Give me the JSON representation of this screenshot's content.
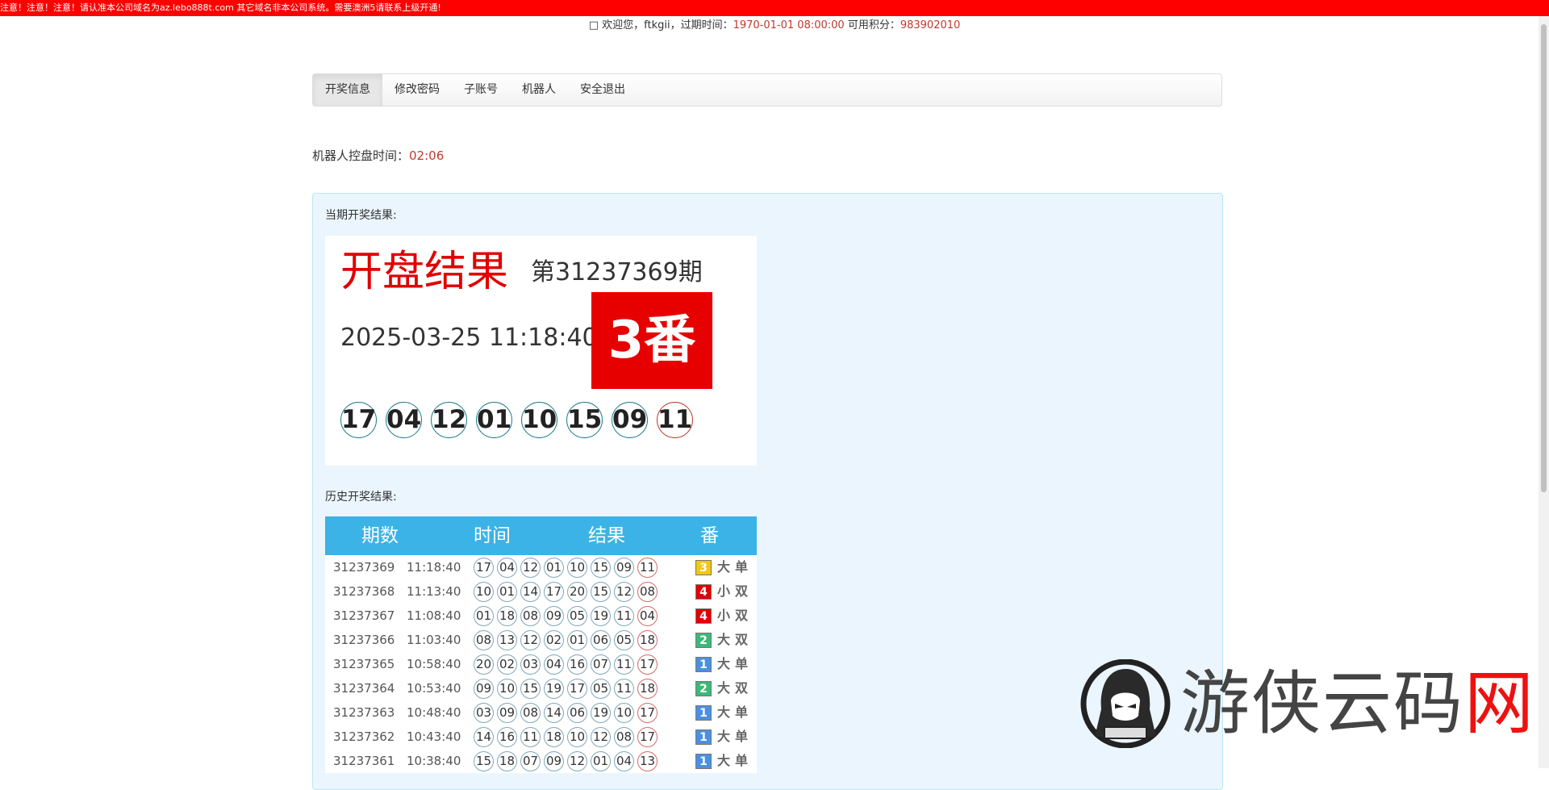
{
  "notice": "注意！注意！注意！请认准本公司域名为az.lebo888t.com 其它域名非本公司系统。需要澳洲5请联系上级开通!",
  "userbar": {
    "icon": "user-icon",
    "welcome_prefix": "欢迎您，",
    "username": "ftkgii",
    "expire_label": "，过期时间：",
    "expire_value": "1970-01-01 08:00:00",
    "points_label": "可用积分：",
    "points_value": "983902010"
  },
  "nav": {
    "tabs": [
      "开奖信息",
      "修改密码",
      "子账号",
      "机器人",
      "安全退出"
    ],
    "active_index": 0
  },
  "robot": {
    "label": "机器人控盘时间：",
    "value": "02:06"
  },
  "current": {
    "section_label": "当期开奖结果:",
    "title": "开盘结果",
    "issue": "第31237369期",
    "time": "2025-03-25 11:18:40",
    "fan": "3番",
    "balls": [
      "17",
      "04",
      "12",
      "01",
      "10",
      "15",
      "09",
      "11"
    ]
  },
  "history": {
    "section_label": "历史开奖结果:",
    "headers": [
      "期数",
      "时间",
      "结果",
      "番"
    ],
    "rows": [
      {
        "issue": "31237369",
        "time": "11:18:40",
        "balls": [
          "17",
          "04",
          "12",
          "01",
          "10",
          "15",
          "09",
          "11"
        ],
        "fan": "3",
        "fan_color": "#f2c811",
        "size": "大",
        "parity": "单"
      },
      {
        "issue": "31237368",
        "time": "11:13:40",
        "balls": [
          "10",
          "01",
          "14",
          "17",
          "20",
          "15",
          "12",
          "08"
        ],
        "fan": "4",
        "fan_color": "#e10000",
        "size": "小",
        "parity": "双"
      },
      {
        "issue": "31237367",
        "time": "11:08:40",
        "balls": [
          "01",
          "18",
          "08",
          "09",
          "05",
          "19",
          "11",
          "04"
        ],
        "fan": "4",
        "fan_color": "#e10000",
        "size": "小",
        "parity": "双"
      },
      {
        "issue": "31237366",
        "time": "11:03:40",
        "balls": [
          "08",
          "13",
          "12",
          "02",
          "01",
          "06",
          "05",
          "18"
        ],
        "fan": "2",
        "fan_color": "#3cb878",
        "size": "大",
        "parity": "双"
      },
      {
        "issue": "31237365",
        "time": "10:58:40",
        "balls": [
          "20",
          "02",
          "03",
          "04",
          "16",
          "07",
          "11",
          "17"
        ],
        "fan": "1",
        "fan_color": "#4a90e2",
        "size": "大",
        "parity": "单"
      },
      {
        "issue": "31237364",
        "time": "10:53:40",
        "balls": [
          "09",
          "10",
          "15",
          "19",
          "17",
          "05",
          "11",
          "18"
        ],
        "fan": "2",
        "fan_color": "#3cb878",
        "size": "大",
        "parity": "双"
      },
      {
        "issue": "31237363",
        "time": "10:48:40",
        "balls": [
          "03",
          "09",
          "08",
          "14",
          "06",
          "19",
          "10",
          "17"
        ],
        "fan": "1",
        "fan_color": "#4a90e2",
        "size": "大",
        "parity": "单"
      },
      {
        "issue": "31237362",
        "time": "10:43:40",
        "balls": [
          "14",
          "16",
          "11",
          "18",
          "10",
          "12",
          "08",
          "17"
        ],
        "fan": "1",
        "fan_color": "#4a90e2",
        "size": "大",
        "parity": "单"
      },
      {
        "issue": "31237361",
        "time": "10:38:40",
        "balls": [
          "15",
          "18",
          "07",
          "09",
          "12",
          "01",
          "04",
          "13"
        ],
        "fan": "1",
        "fan_color": "#4a90e2",
        "size": "大",
        "parity": "单"
      }
    ]
  },
  "watermark": {
    "logo": "hacker-hood-logo",
    "text_main": "游侠云码",
    "text_red": "网"
  }
}
